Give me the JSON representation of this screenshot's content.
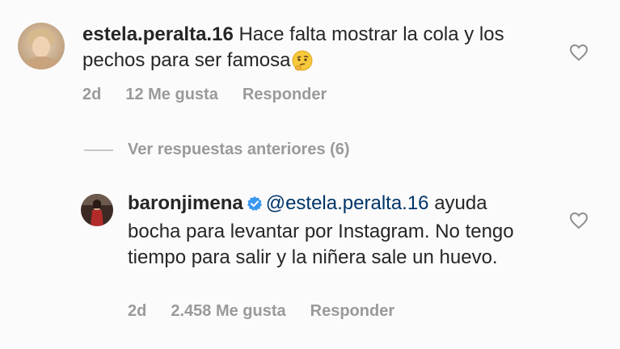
{
  "comments": [
    {
      "username": "estela.peralta.16",
      "text": "Hace falta mostrar la cola y los pechos para ser famosa",
      "emoji_icon": "thinking-face-emoji",
      "time": "2d",
      "likes": "12 Me gusta",
      "reply_label": "Responder"
    }
  ],
  "view_replies": {
    "label": "Ver respuestas anteriores (6)"
  },
  "reply": {
    "username": "baronjimena",
    "verified": true,
    "mention": "@estela.peralta.16",
    "text": " ayuda bocha para levantar por Instagram. No tengo tiempo para salir y la niñera sale un huevo.",
    "time": "2d",
    "likes": "2.458 Me gusta",
    "reply_label": "Responder"
  },
  "colors": {
    "username": "#262626",
    "mention": "#003569",
    "meta": "#9a9a9a",
    "verified_badge": "#3897f0"
  }
}
